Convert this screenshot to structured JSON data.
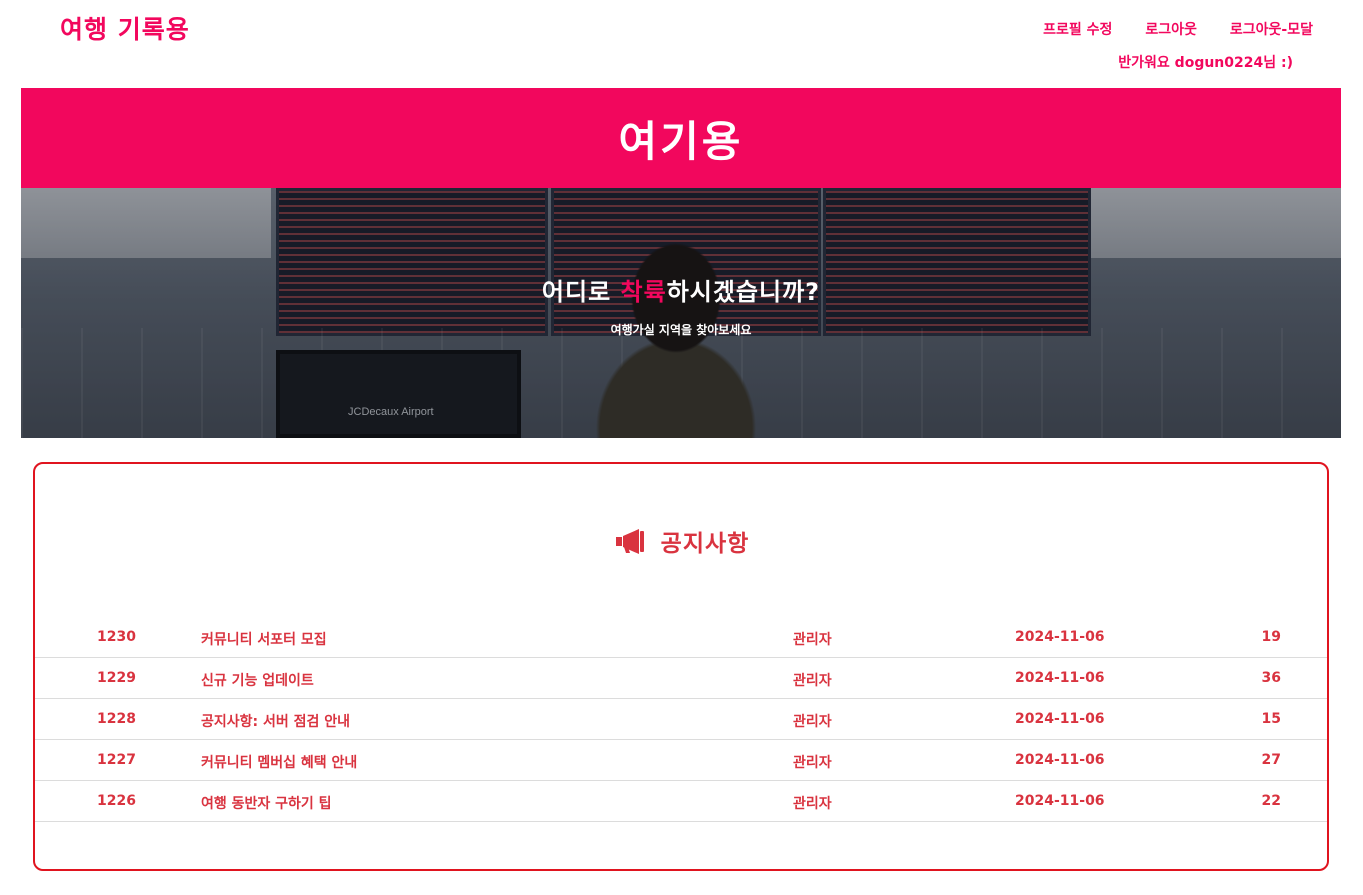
{
  "header": {
    "logo": "여행 기록용",
    "nav": [
      {
        "label": "프로필 수정"
      },
      {
        "label": "로그아웃"
      },
      {
        "label": "로그아웃-모달"
      }
    ],
    "greeting": "반가워요 dogun0224님 :)"
  },
  "banner": {
    "title": "여기용"
  },
  "hero": {
    "heading_pre": "어디로 ",
    "heading_accent": "착륙",
    "heading_post": "하시겠습니까?",
    "subheading": "여행가실 지역을 찾아보세요",
    "kiosk_sign": "JCDecaux Airport"
  },
  "notice": {
    "icon": "megaphone-icon",
    "title": "공지사항",
    "rows": [
      {
        "no": "1230",
        "title": "커뮤니티 서포터 모집",
        "author": "관리자",
        "date": "2024-11-06",
        "views": "19"
      },
      {
        "no": "1229",
        "title": "신규 기능 업데이트",
        "author": "관리자",
        "date": "2024-11-06",
        "views": "36"
      },
      {
        "no": "1228",
        "title": "공지사항: 서버 점검 안내",
        "author": "관리자",
        "date": "2024-11-06",
        "views": "15"
      },
      {
        "no": "1227",
        "title": "커뮤니티 멤버십 혜택 안내",
        "author": "관리자",
        "date": "2024-11-06",
        "views": "27"
      },
      {
        "no": "1226",
        "title": "여행 동반자 구하기 팁",
        "author": "관리자",
        "date": "2024-11-06",
        "views": "22"
      }
    ]
  },
  "colors": {
    "brand": "#f2075d",
    "notice_red": "#d9333f",
    "card_border": "#e0141f"
  }
}
